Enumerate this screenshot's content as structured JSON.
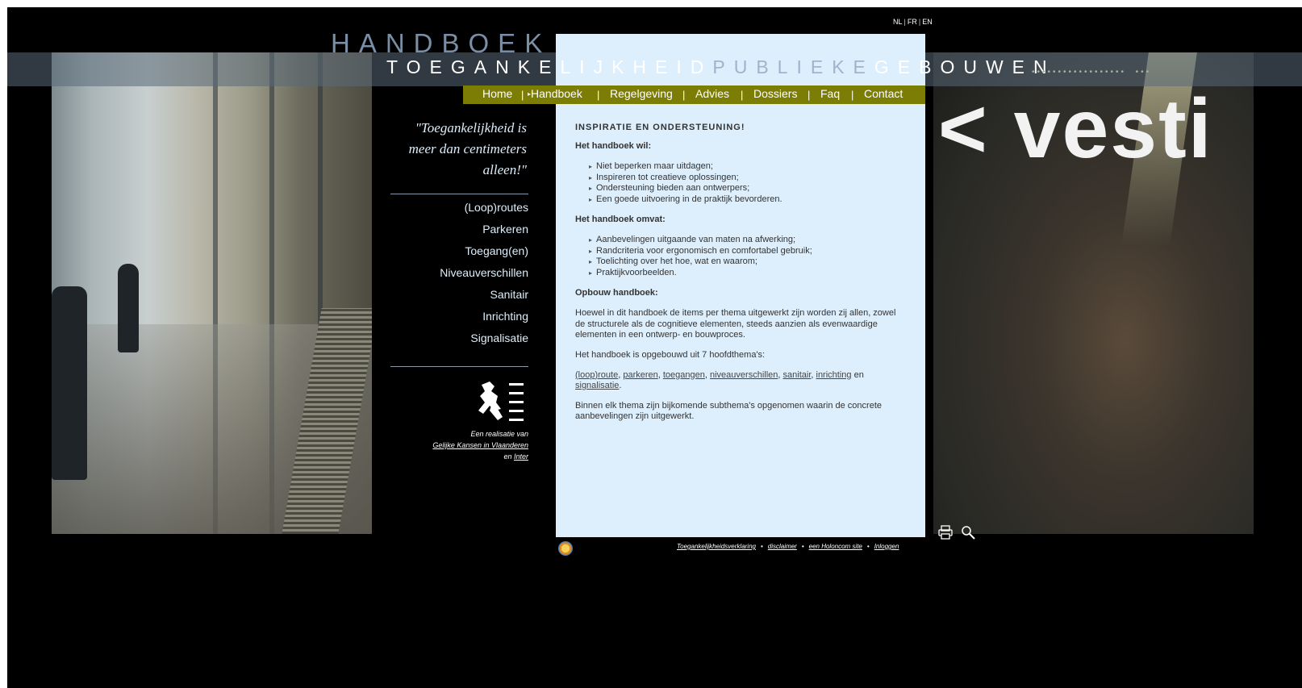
{
  "header": {
    "title_small": "HANDBOEK",
    "title_big": [
      "TOEGANKELIJKHEID",
      "PUBLIEKE",
      "GEBOUWEN"
    ],
    "languages": [
      "NL",
      "FR",
      "EN"
    ],
    "right_image_text": "< vesti"
  },
  "nav": {
    "items": [
      "Home",
      "Handboek",
      "Regelgeving",
      "Advies",
      "Dossiers",
      "Faq",
      "Contact"
    ],
    "active": "Handboek"
  },
  "sidebar": {
    "quote": "\"Toegankelijkheid is meer dan centimeters alleen!\"",
    "themes": [
      "(Loop)routes",
      "Parkeren",
      "Toegang(en)",
      "Niveauverschillen",
      "Sanitair",
      "Inrichting",
      "Signalisatie"
    ],
    "credits": {
      "line1": "Een realisatie van",
      "link1": "Gelijke Kansen in Vlaanderen",
      "line3_prefix": "en",
      "link2": "Inter"
    }
  },
  "content": {
    "heading": "INSPIRATIE EN ONDERSTEUNING!",
    "section1_title": "Het handboek wil:",
    "section1_items": [
      "Niet beperken maar uitdagen;",
      "Inspireren tot creatieve oplossingen;",
      "Ondersteuning bieden aan ontwerpers;",
      "Een goede uitvoering in de praktijk bevorderen."
    ],
    "section2_title": "Het handboek omvat:",
    "section2_items": [
      "Aanbevelingen uitgaande van maten na afwerking;",
      "Randcriteria voor ergonomisch en comfortabel gebruik;",
      "Toelichting over het hoe, wat en waarom;",
      "Praktijkvoorbeelden."
    ],
    "section3_title": "Opbouw handboek:",
    "para1": "Hoewel in dit handboek de items per thema uitgewerkt zijn worden zij allen, zowel de structurele als de cognitieve elementen, steeds aanzien als evenwaardige elementen in een ontwerp- en bouwproces.",
    "para2": "Het handboek is opgebouwd uit 7 hoofdthema's:",
    "theme_links": [
      "(loop)route",
      "parkeren",
      "toegangen",
      "niveauverschillen",
      "sanitair",
      "inrichting",
      "signalisatie"
    ],
    "theme_links_joiner": "en",
    "para3": "Binnen elk thema zijn bijkomende subthema's opgenomen waarin de concrete aanbevelingen zijn uitgewerkt."
  },
  "footer": {
    "links": [
      "Toegankelijkheidsverklaring",
      "disclaimer",
      "een Holoncom site",
      "Inloggen"
    ]
  },
  "icons": {
    "print": "print-icon",
    "search": "search-icon",
    "logo": "flemish-lion-logo"
  },
  "colors": {
    "navbar": "#7c7d05",
    "panel": "#ddeefc",
    "title_accent": "#9fb4cc"
  }
}
